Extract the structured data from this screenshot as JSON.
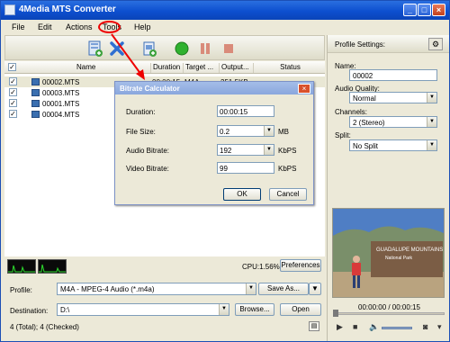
{
  "window": {
    "title": "4Media MTS Converter"
  },
  "menu": {
    "file": "File",
    "edit": "Edit",
    "actions": "Actions",
    "tools": "Tools",
    "help": "Help"
  },
  "list": {
    "headers": {
      "name": "Name",
      "duration": "Duration",
      "target": "Target ...",
      "output": "Output...",
      "status": "Status"
    },
    "rows": [
      {
        "name": "00002.MTS",
        "duration": "00:00:15",
        "target": "M4A",
        "output": "251.5KB"
      },
      {
        "name": "00003.MTS"
      },
      {
        "name": "00001.MTS"
      },
      {
        "name": "00004.MTS"
      }
    ]
  },
  "dialog": {
    "title": "Bitrate Calculator",
    "duration_label": "Duration:",
    "duration_value": "00:00:15",
    "filesize_label": "File Size:",
    "filesize_value": "0.2",
    "filesize_unit": "MB",
    "audio_label": "Audio Bitrate:",
    "audio_value": "192",
    "audio_unit": "KbPS",
    "video_label": "Video Bitrate:",
    "video_value": "99",
    "video_unit": "KbPS",
    "ok": "OK",
    "cancel": "Cancel"
  },
  "cpu": {
    "text": "CPU:1.56%",
    "preferences": "Preferences"
  },
  "bottom": {
    "profile_label": "Profile:",
    "profile_value": "M4A - MPEG-4 Audio (*.m4a)",
    "save_as": "Save As...",
    "destination_label": "Destination:",
    "destination_value": "D:\\",
    "browse": "Browse...",
    "open": "Open"
  },
  "status": {
    "text": "4 (Total); 4 (Checked)"
  },
  "right_pane": {
    "header": "Profile Settings:",
    "name_label": "Name:",
    "name_value": "00002",
    "audio_quality_label": "Audio Quality:",
    "audio_quality_value": "Normal",
    "channels_label": "Channels:",
    "channels_value": "2 (Stereo)",
    "split_label": "Split:",
    "split_value": "No Split",
    "time": "00:00:00 / 00:00:15",
    "preview_sign_line1": "GUADALUPE MOUNTAINS",
    "preview_sign_line2": "National Park"
  }
}
